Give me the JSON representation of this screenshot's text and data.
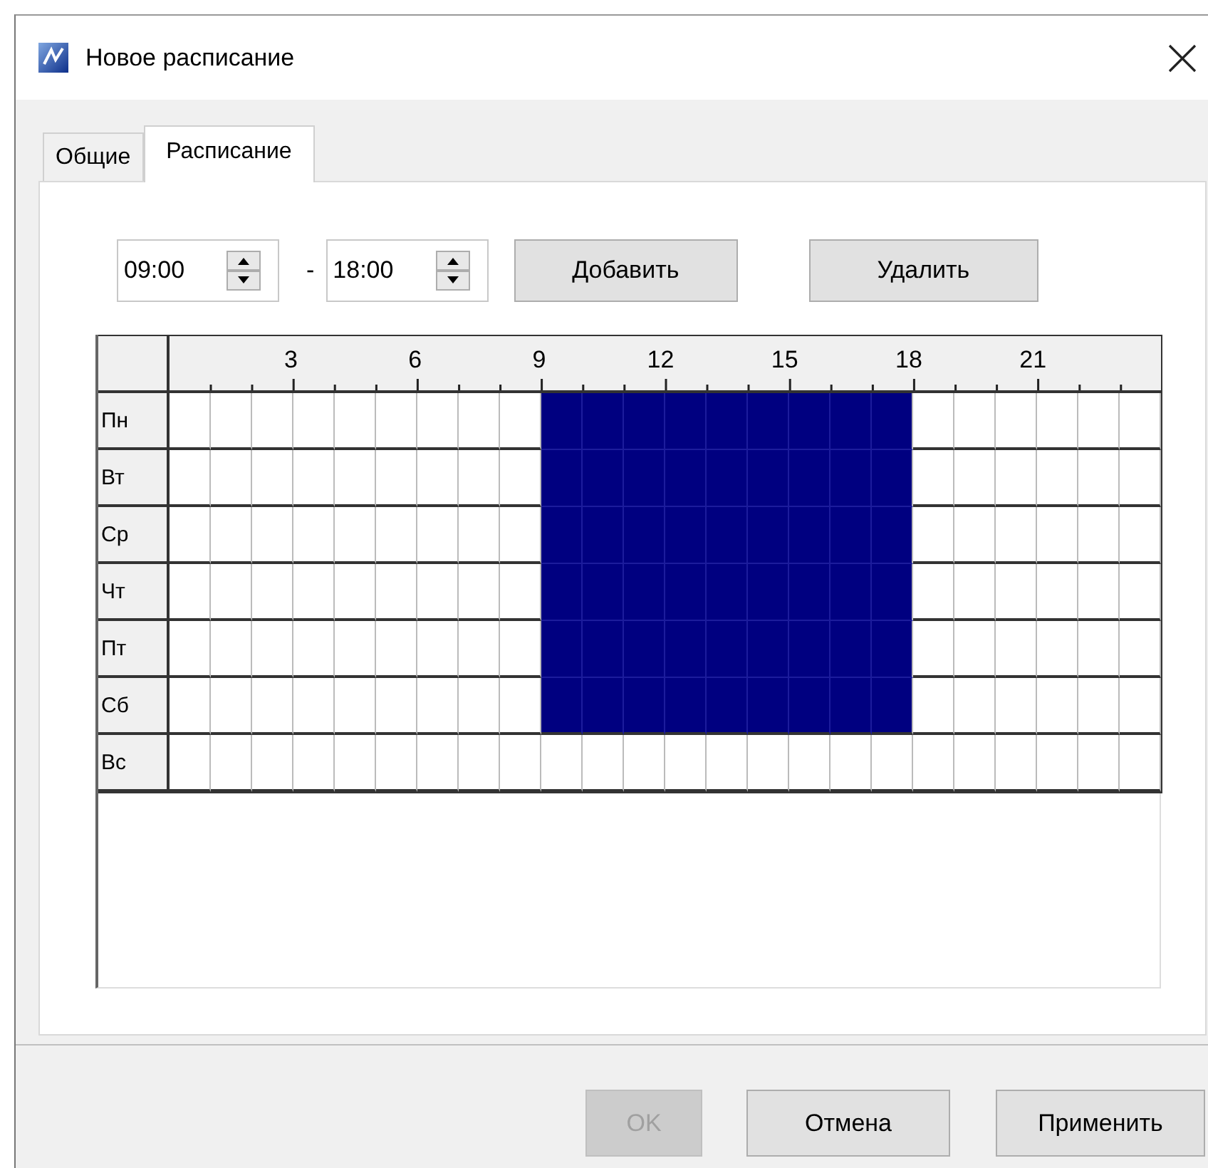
{
  "window": {
    "title": "Новое расписание"
  },
  "tabs": [
    {
      "label": "Общие",
      "selected": false
    },
    {
      "label": "Расписание",
      "selected": true
    }
  ],
  "time_from": {
    "value": "09:00"
  },
  "separator": "-",
  "time_to": {
    "value": "18:00"
  },
  "actions": [
    {
      "label": "Добавить"
    },
    {
      "label": "Удалить"
    }
  ],
  "schedule": {
    "hour_labels": [
      {
        "label": "3"
      },
      {
        "label": "6"
      },
      {
        "label": "9"
      },
      {
        "label": "12"
      },
      {
        "label": "15"
      },
      {
        "label": "18"
      },
      {
        "label": "21"
      }
    ],
    "days": [
      {
        "label": "Пн",
        "hours": [
          false,
          false,
          false,
          false,
          false,
          false,
          false,
          false,
          false,
          true,
          true,
          true,
          true,
          true,
          true,
          true,
          true,
          true,
          false,
          false,
          false,
          false,
          false,
          false
        ]
      },
      {
        "label": "Вт",
        "hours": [
          false,
          false,
          false,
          false,
          false,
          false,
          false,
          false,
          false,
          true,
          true,
          true,
          true,
          true,
          true,
          true,
          true,
          true,
          false,
          false,
          false,
          false,
          false,
          false
        ]
      },
      {
        "label": "Ср",
        "hours": [
          false,
          false,
          false,
          false,
          false,
          false,
          false,
          false,
          false,
          true,
          true,
          true,
          true,
          true,
          true,
          true,
          true,
          true,
          false,
          false,
          false,
          false,
          false,
          false
        ]
      },
      {
        "label": "Чт",
        "hours": [
          false,
          false,
          false,
          false,
          false,
          false,
          false,
          false,
          false,
          true,
          true,
          true,
          true,
          true,
          true,
          true,
          true,
          true,
          false,
          false,
          false,
          false,
          false,
          false
        ]
      },
      {
        "label": "Пт",
        "hours": [
          false,
          false,
          false,
          false,
          false,
          false,
          false,
          false,
          false,
          true,
          true,
          true,
          true,
          true,
          true,
          true,
          true,
          true,
          false,
          false,
          false,
          false,
          false,
          false
        ]
      },
      {
        "label": "Сб",
        "hours": [
          false,
          false,
          false,
          false,
          false,
          false,
          false,
          false,
          false,
          true,
          true,
          true,
          true,
          true,
          true,
          true,
          true,
          true,
          false,
          false,
          false,
          false,
          false,
          false
        ]
      },
      {
        "label": "Вс",
        "hours": [
          false,
          false,
          false,
          false,
          false,
          false,
          false,
          false,
          false,
          false,
          false,
          false,
          false,
          false,
          false,
          false,
          false,
          false,
          false,
          false,
          false,
          false,
          false,
          false
        ]
      }
    ]
  },
  "footer_buttons": [
    {
      "label": "OK",
      "disabled": true
    },
    {
      "label": "Отмена",
      "disabled": false
    },
    {
      "label": "Применить",
      "disabled": false
    }
  ]
}
